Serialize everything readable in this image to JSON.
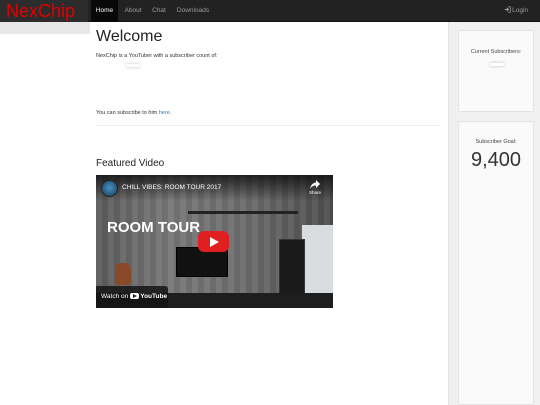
{
  "nav": {
    "brand": "NexChip",
    "items": [
      "Home",
      "About",
      "Chat",
      "Downloads"
    ],
    "active": "Home",
    "login_label": "Login"
  },
  "main": {
    "heading": "Welcome",
    "intro": "NexChip is a YouTuber with a subscriber count of:",
    "subscribe_prefix": "You can subscribe to him ",
    "subscribe_link": "here",
    "subscribe_suffix": ".",
    "featured_heading": "Featured Video"
  },
  "video": {
    "title": "CHILL VIBES: ROOM TOUR 2017",
    "share_label": "Share",
    "overlay_text": "ROOM TOUR",
    "watch_on": "Watch on",
    "platform": "YouTube"
  },
  "sidebar": {
    "current_label": "Current Subscribers:",
    "goal_label": "Subscriber Goal:",
    "goal_value": "9,400"
  },
  "colors": {
    "brand": "#e00000",
    "navbar": "#222222",
    "link": "#337ab7",
    "play_button": "#e02020"
  }
}
